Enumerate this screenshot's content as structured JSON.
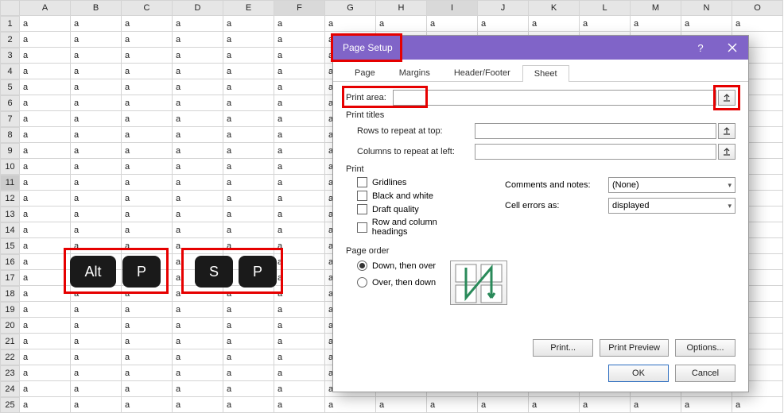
{
  "columns": [
    "A",
    "B",
    "C",
    "D",
    "E",
    "F",
    "G",
    "H",
    "I",
    "J",
    "K",
    "L",
    "M",
    "N",
    "O"
  ],
  "row_count": 25,
  "cell_value": "a",
  "active_col": "F",
  "active_col2": "I",
  "active_row": 11,
  "keys": {
    "alt": "Alt",
    "p1": "P",
    "s": "S",
    "p2": "P"
  },
  "dialog": {
    "title": "Page Setup",
    "tabs": [
      "Page",
      "Margins",
      "Header/Footer",
      "Sheet"
    ],
    "active_tab": "Sheet",
    "print_area_label": "Print area:",
    "print_area_value": "",
    "print_titles_label": "Print titles",
    "rows_repeat_label": "Rows to repeat at top:",
    "rows_repeat_value": "",
    "cols_repeat_label": "Columns to repeat at left:",
    "cols_repeat_value": "",
    "print_section": "Print",
    "chk_gridlines": "Gridlines",
    "chk_bw": "Black and white",
    "chk_draft": "Draft quality",
    "chk_rowcol": "Row and column headings",
    "comments_label": "Comments and notes:",
    "comments_value": "(None)",
    "cell_errors_label": "Cell errors as:",
    "cell_errors_value": "displayed",
    "page_order_label": "Page order",
    "opt_down": "Down, then over",
    "opt_over": "Over, then down",
    "btn_print": "Print...",
    "btn_preview": "Print Preview",
    "btn_options": "Options...",
    "btn_ok": "OK",
    "btn_cancel": "Cancel"
  }
}
